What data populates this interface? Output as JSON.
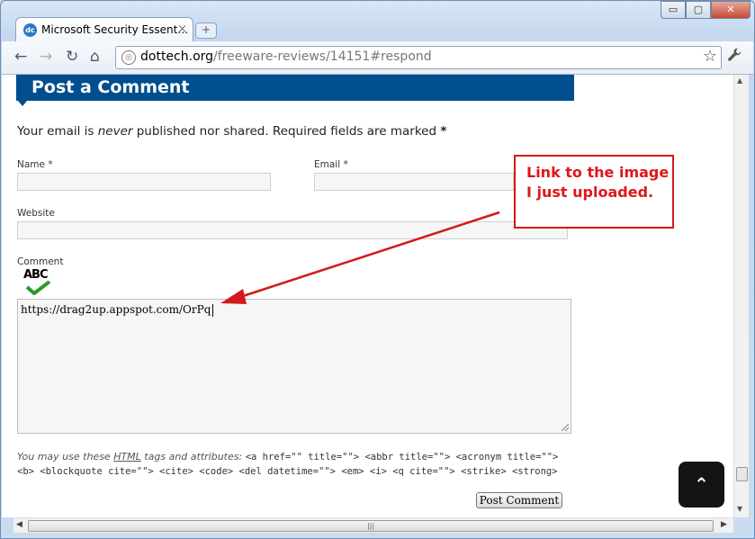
{
  "browser": {
    "tab_title": "Microsoft Security Essent…",
    "tab_favicon": "dc",
    "tab_close": "×",
    "new_tab": "+",
    "window_controls": {
      "minimize": "▭",
      "maximize": "▢",
      "close": "✕"
    },
    "nav": {
      "back": "←",
      "forward": "→",
      "reload": "↻",
      "home": "⌂"
    },
    "url_host": "dottech.org",
    "url_path": "/freeware-reviews/14151#respond",
    "star": "☆",
    "wrench": "🔧"
  },
  "form": {
    "heading": "Post a Comment",
    "note_prefix": "Your email is ",
    "note_em": "never",
    "note_suffix": " published nor shared. Required fields are marked ",
    "note_star": "*",
    "name_label": "Name *",
    "email_label": "Email *",
    "website_label": "Website",
    "comment_label": "Comment",
    "spellcheck_text": "ABC",
    "comment_value": "https://drag2up.appspot.com/OrPq",
    "tags_prefix": "You may use these ",
    "tags_html": "HTML",
    "tags_mid": " tags and attributes: ",
    "tags_code": "<a href=\"\" title=\"\"> <abbr title=\"\"> <acronym title=\"\"> <b> <blockquote cite=\"\"> <cite> <code> <del datetime=\"\"> <em> <i> <q cite=\"\"> <strike> <strong>",
    "submit_label": "Post Comment"
  },
  "annotation": {
    "callout_text": "Link to the image I just uploaded.",
    "color": "#d21a1a"
  },
  "back_to_top": "⌃",
  "scroll": {
    "up": "▲",
    "down": "▼",
    "left": "◀",
    "right": "▶",
    "grip": "|||"
  }
}
